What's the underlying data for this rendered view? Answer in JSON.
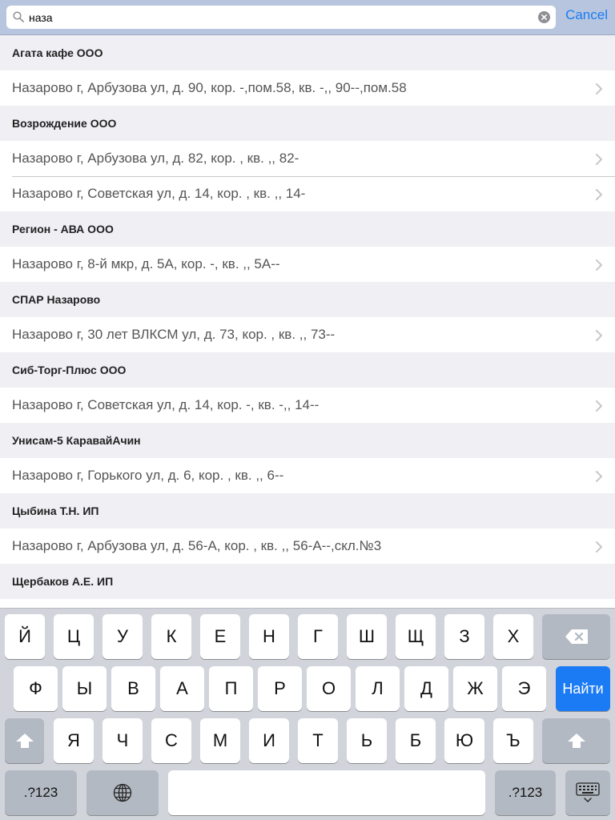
{
  "search": {
    "value": "наза",
    "cancel_label": "Cancel"
  },
  "sections": [
    {
      "title": "Агата кафе ООО",
      "rows": [
        "Назарово г, Арбузова ул,  д. 90, кор. -,пом.58, кв. -,, 90--,пом.58"
      ]
    },
    {
      "title": "Возрождение ООО",
      "rows": [
        "Назарово г, Арбузова ул,  д. 82, кор. , кв. ,, 82-",
        "Назарово г, Советская ул,  д. 14, кор. , кв. ,, 14-"
      ]
    },
    {
      "title": "Регион - АВА ООО",
      "rows": [
        "Назарово г, 8-й мкр,  д. 5А, кор. -, кв. ,, 5А--"
      ]
    },
    {
      "title": "СПАР Назарово",
      "rows": [
        "Назарово г, 30 лет ВЛКСМ ул,  д. 73, кор. , кв. ,, 73--"
      ]
    },
    {
      "title": "Сиб-Торг-Плюс ООО",
      "rows": [
        "Назарово г, Советская ул,  д. 14, кор. -, кв. -,, 14--"
      ]
    },
    {
      "title": "Унисам-5 КаравайАчин",
      "rows": [
        "Назарово г, Горького ул,  д. 6, кор. , кв. ,, 6--"
      ]
    },
    {
      "title": "Цыбина Т.Н. ИП",
      "rows": [
        "Назарово г, Арбузова ул,  д. 56-А, кор. , кв. ,, 56-А--,скл.№3"
      ]
    },
    {
      "title": "Щербаков А.Е. ИП",
      "rows": [
        ""
      ]
    }
  ],
  "keyboard": {
    "row1": [
      "Й",
      "Ц",
      "У",
      "К",
      "Е",
      "Н",
      "Г",
      "Ш",
      "Щ",
      "З",
      "Х"
    ],
    "row2": [
      "Ф",
      "Ы",
      "В",
      "А",
      "П",
      "Р",
      "О",
      "Л",
      "Д",
      "Ж",
      "Э"
    ],
    "row3": [
      "Я",
      "Ч",
      "С",
      "М",
      "И",
      "Т",
      "Ь",
      "Б",
      "Ю",
      "Ъ"
    ],
    "go_label": "Найти",
    "numbers_label": ".?123",
    "icons": {
      "delete": "backspace-icon",
      "shift": "shift-icon",
      "globe": "globe-icon",
      "hide": "keyboard-hide-icon"
    }
  },
  "colors": {
    "accent": "#1a7bf5",
    "search_bar": "#b7c6de",
    "list_bg": "#efeff4",
    "keyboard_bg": "#d1d5db"
  }
}
